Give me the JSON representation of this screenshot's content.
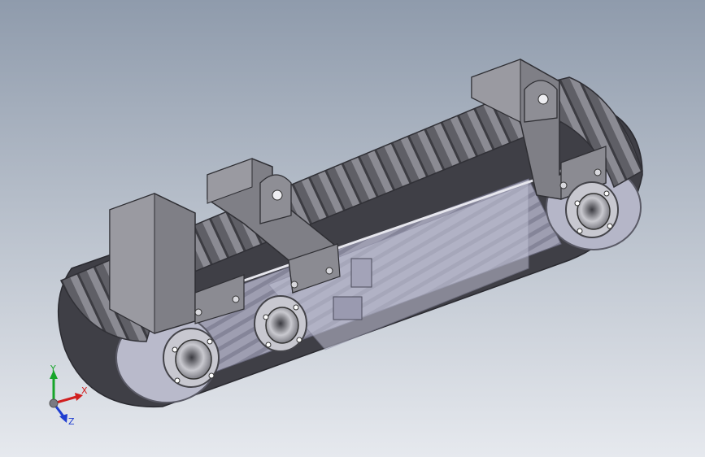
{
  "viewport": {
    "background_top": "#8f9bac",
    "background_bottom": "#e6e9ee"
  },
  "model": {
    "track_color": "#4d4d55",
    "tread_color": "#6b6b72",
    "bracket_color": "#85858c",
    "chassis_color": "#b7b8cc",
    "hub_color": "#9c9ca4"
  },
  "triad": {
    "x_label": "X",
    "y_label": "Y",
    "z_label": "Z",
    "x_color": "#d11f1f",
    "y_color": "#17a52a",
    "z_color": "#1f3ed1"
  }
}
